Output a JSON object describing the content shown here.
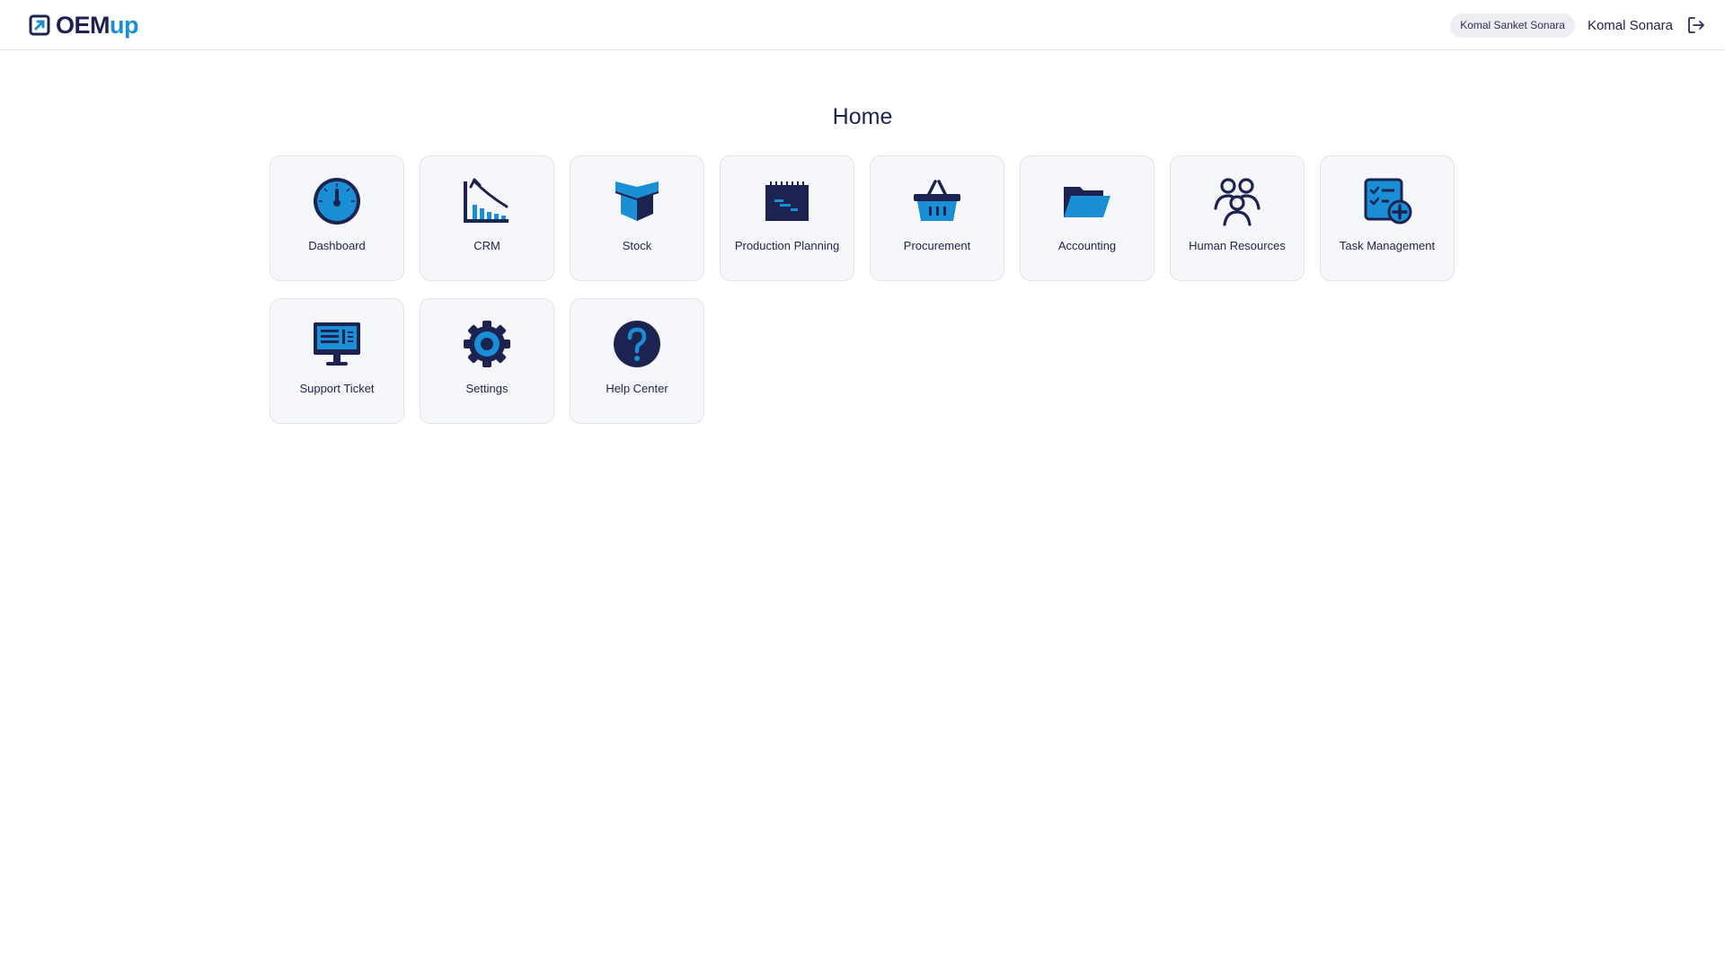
{
  "header": {
    "logo_part1": "OEM",
    "logo_part2": "up",
    "user_chip": "Komal Sanket Sonara",
    "user_name": "Komal Sonara",
    "logout_icon": "logout-icon"
  },
  "page": {
    "title": "Home"
  },
  "modules": [
    {
      "label": "Dashboard",
      "icon": "speedometer-icon"
    },
    {
      "label": "CRM",
      "icon": "growth-chart-icon"
    },
    {
      "label": "Stock",
      "icon": "box-icon"
    },
    {
      "label": "Production Planning",
      "icon": "gantt-calendar-icon"
    },
    {
      "label": "Procurement",
      "icon": "basket-icon"
    },
    {
      "label": "Accounting",
      "icon": "folder-icon"
    },
    {
      "label": "Human Resources",
      "icon": "people-icon"
    },
    {
      "label": "Task Management",
      "icon": "task-add-icon"
    },
    {
      "label": "Support Ticket",
      "icon": "monitor-icon"
    },
    {
      "label": "Settings",
      "icon": "gear-icon"
    },
    {
      "label": "Help Center",
      "icon": "question-icon"
    }
  ],
  "colors": {
    "navy": "#1c2350",
    "blue": "#1a8fd6",
    "tile_bg": "#f6f7fa",
    "tile_border": "#e1e4eb"
  }
}
